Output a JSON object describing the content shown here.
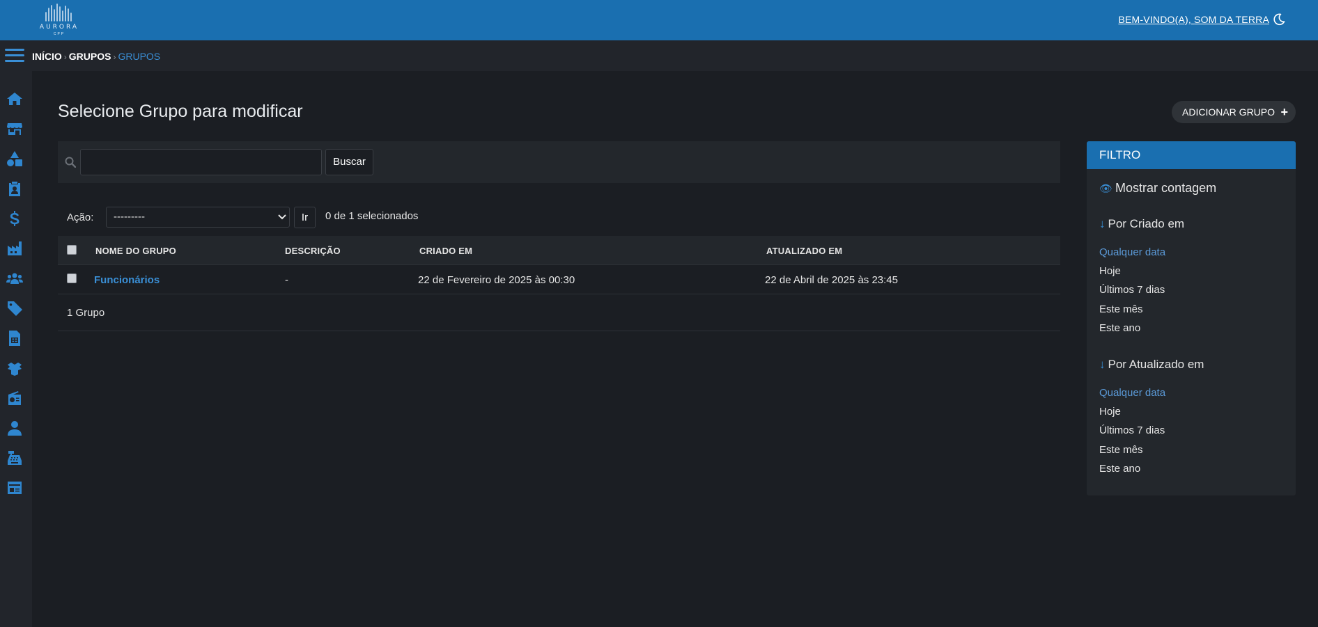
{
  "header": {
    "logo_text": "AURORA",
    "logo_sub": "CPP",
    "welcome_prefix": "BEM-VINDO(A),",
    "welcome_user": "SOM DA TERRA",
    "theme_icon": "moon-icon"
  },
  "breadcrumb": {
    "home": "INÍCIO",
    "section": "GRUPOS",
    "current": "GRUPOS",
    "separator": "›"
  },
  "sidebar": {
    "icons": [
      "home-icon",
      "store-icon",
      "shapes-icon",
      "clipboard-user-icon",
      "dollar-icon",
      "factory-icon",
      "users-icon",
      "tag-icon",
      "file-invoice-icon",
      "boxes-icon",
      "radio-icon",
      "user-icon",
      "cash-register-icon",
      "id-card-icon"
    ]
  },
  "main": {
    "title": "Selecione Grupo para modificar",
    "add_button": "ADICIONAR GRUPO",
    "search": {
      "value": "",
      "placeholder": "",
      "button": "Buscar"
    },
    "action": {
      "label": "Ação:",
      "selected": "---------",
      "go": "Ir",
      "selection": "0 de 1 selecionados"
    },
    "table": {
      "columns": [
        "NOME DO GRUPO",
        "DESCRIÇÃO",
        "CRIADO EM",
        "ATUALIZADO EM"
      ],
      "rows": [
        {
          "name": "Funcionários",
          "description": "-",
          "created": "22 de Fevereiro de 2025 às 00:30",
          "updated": "22 de Abril de 2025 às 23:45"
        }
      ],
      "footer": "1 Grupo"
    }
  },
  "filter": {
    "title": "FILTRO",
    "show_count": "Mostrar contagem",
    "groups": [
      {
        "title": "Por Criado em",
        "items": [
          "Qualquer data",
          "Hoje",
          "Últimos 7 dias",
          "Este mês",
          "Este ano"
        ]
      },
      {
        "title": "Por Atualizado em",
        "items": [
          "Qualquer data",
          "Hoje",
          "Últimos 7 dias",
          "Este mês",
          "Este ano"
        ]
      }
    ],
    "arrow": "↓"
  },
  "colors": {
    "accent": "#1a6fb0",
    "link": "#3a8fd6",
    "background": "#1b1e23"
  }
}
